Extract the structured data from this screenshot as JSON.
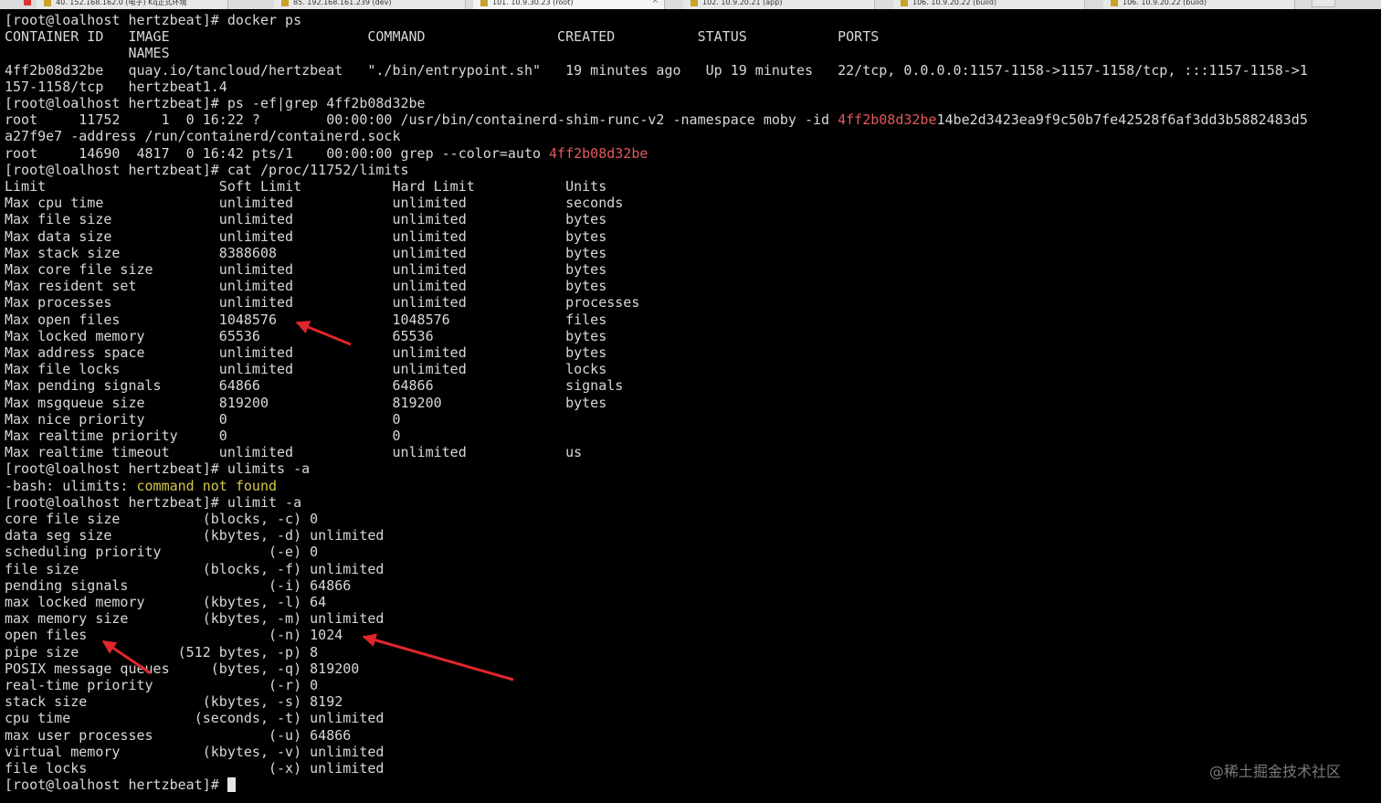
{
  "tabs": [
    {
      "label": "40. 152.168.162.0 (电子) Kq正式环境",
      "active": false
    },
    {
      "label": "85. 192.168.161.239 (dev)",
      "active": false
    },
    {
      "label": "101. 10.9.30.23 (root)",
      "active": true
    },
    {
      "label": "102. 10.9.20.21 (app)",
      "active": false
    },
    {
      "label": "106. 10.9.20.22 (build)",
      "active": false
    },
    {
      "label": "106. 10.9.20.22 (build)",
      "active": false
    }
  ],
  "tab_close_glyph": "×",
  "terminal": {
    "lines": [
      {
        "text": "[root@loalhost hertzbeat]# docker ps"
      },
      {
        "text": "CONTAINER ID   IMAGE                        COMMAND                CREATED          STATUS           PORTS"
      },
      {
        "text": "               NAMES"
      },
      {
        "text": "4ff2b08d32be   quay.io/tancloud/hertzbeat   \"./bin/entrypoint.sh\"   19 minutes ago   Up 19 minutes   22/tcp, 0.0.0.0:1157-1158->1157-1158/tcp, :::1157-1158->1"
      },
      {
        "text": "157-1158/tcp   hertzbeat1.4"
      },
      {
        "text": "[root@loalhost hertzbeat]# ps -ef|grep 4ff2b08d32be"
      },
      {
        "text": "root     11752     1  0 16:22 ?        00:00:00 /usr/bin/containerd-shim-runc-v2 -namespace moby -id ",
        "hl": "4ff2b08d32be",
        "tail": "14be2d3423ea9f9c50b7fe42528f6af3dd3b5882483d5"
      },
      {
        "text": "a27f9e7 -address /run/containerd/containerd.sock"
      },
      {
        "text": "root     14690  4817  0 16:42 pts/1    00:00:00 grep --color=auto ",
        "hl": "4ff2b08d32be"
      },
      {
        "text": "[root@loalhost hertzbeat]# cat /proc/11752/limits"
      },
      {
        "text": "Limit                     Soft Limit           Hard Limit           Units"
      },
      {
        "text": "Max cpu time              unlimited            unlimited            seconds"
      },
      {
        "text": "Max file size             unlimited            unlimited            bytes"
      },
      {
        "text": "Max data size             unlimited            unlimited            bytes"
      },
      {
        "text": "Max stack size            8388608              unlimited            bytes"
      },
      {
        "text": "Max core file size        unlimited            unlimited            bytes"
      },
      {
        "text": "Max resident set          unlimited            unlimited            bytes"
      },
      {
        "text": "Max processes             unlimited            unlimited            processes"
      },
      {
        "text": "Max open files            1048576              1048576              files"
      },
      {
        "text": "Max locked memory         65536                65536                bytes"
      },
      {
        "text": "Max address space         unlimited            unlimited            bytes"
      },
      {
        "text": "Max file locks            unlimited            unlimited            locks"
      },
      {
        "text": "Max pending signals       64866                64866                signals"
      },
      {
        "text": "Max msgqueue size         819200               819200               bytes"
      },
      {
        "text": "Max nice priority         0                    0"
      },
      {
        "text": "Max realtime priority     0                    0"
      },
      {
        "text": "Max realtime timeout      unlimited            unlimited            us"
      },
      {
        "text": "[root@loalhost hertzbeat]# ulimits -a"
      },
      {
        "text": "-bash: ulimits: ",
        "yellow": "command not found"
      },
      {
        "text": "[root@loalhost hertzbeat]# ulimit -a"
      },
      {
        "text": "core file size          (blocks, -c) 0"
      },
      {
        "text": "data seg size           (kbytes, -d) unlimited"
      },
      {
        "text": "scheduling priority             (-e) 0"
      },
      {
        "text": "file size               (blocks, -f) unlimited"
      },
      {
        "text": "pending signals                 (-i) 64866"
      },
      {
        "text": "max locked memory       (kbytes, -l) 64"
      },
      {
        "text": "max memory size         (kbytes, -m) unlimited"
      },
      {
        "text": "open files                      (-n) 1024"
      },
      {
        "text": "pipe size            (512 bytes, -p) 8"
      },
      {
        "text": "POSIX message queues     (bytes, -q) 819200"
      },
      {
        "text": "real-time priority              (-r) 0"
      },
      {
        "text": "stack size              (kbytes, -s) 8192"
      },
      {
        "text": "cpu time               (seconds, -t) unlimited"
      },
      {
        "text": "max user processes              (-u) 64866"
      },
      {
        "text": "virtual memory          (kbytes, -v) unlimited"
      },
      {
        "text": "file locks                      (-x) unlimited"
      },
      {
        "text": "[root@loalhost hertzbeat]# ",
        "cursor": true
      }
    ]
  },
  "watermark": "@稀土掘金技术社区",
  "colors": {
    "background": "#000000",
    "text": "#d8d8d8",
    "highlight_match": "#e3585c",
    "error_text": "#d6c84a",
    "annotation_arrow": "#e0262b"
  }
}
